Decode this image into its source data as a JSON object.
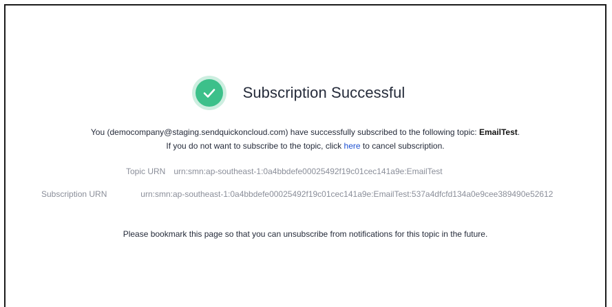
{
  "title": "Subscription Successful",
  "colors": {
    "success_green": "#3cc08a",
    "success_green_halo": "#cdeee0",
    "link_blue": "#1b4fd1",
    "muted_gray": "#8a8e99"
  },
  "icons": {
    "status": "check-circle-icon"
  },
  "message": {
    "prefix": "You (democompany@staging.sendquickoncloud.com) have successfully subscribed to the following topic: ",
    "topic": "EmailTest",
    "suffix": "."
  },
  "cancel": {
    "prefix": "If you do not want to subscribe to the topic, click ",
    "link_text": "here",
    "suffix": " to cancel subscription."
  },
  "topic_urn": {
    "label": "Topic URN",
    "value": "urn:smn:ap-southeast-1:0a4bbdefe00025492f19c01cec141a9e:EmailTest"
  },
  "subscription_urn": {
    "label": "Subscription URN",
    "value": "urn:smn:ap-southeast-1:0a4bbdefe00025492f19c01cec141a9e:EmailTest:537a4dfcfd134a0e9cee389490e52612"
  },
  "bookmark_note": "Please bookmark this page so that you can unsubscribe from notifications for this topic in the future."
}
